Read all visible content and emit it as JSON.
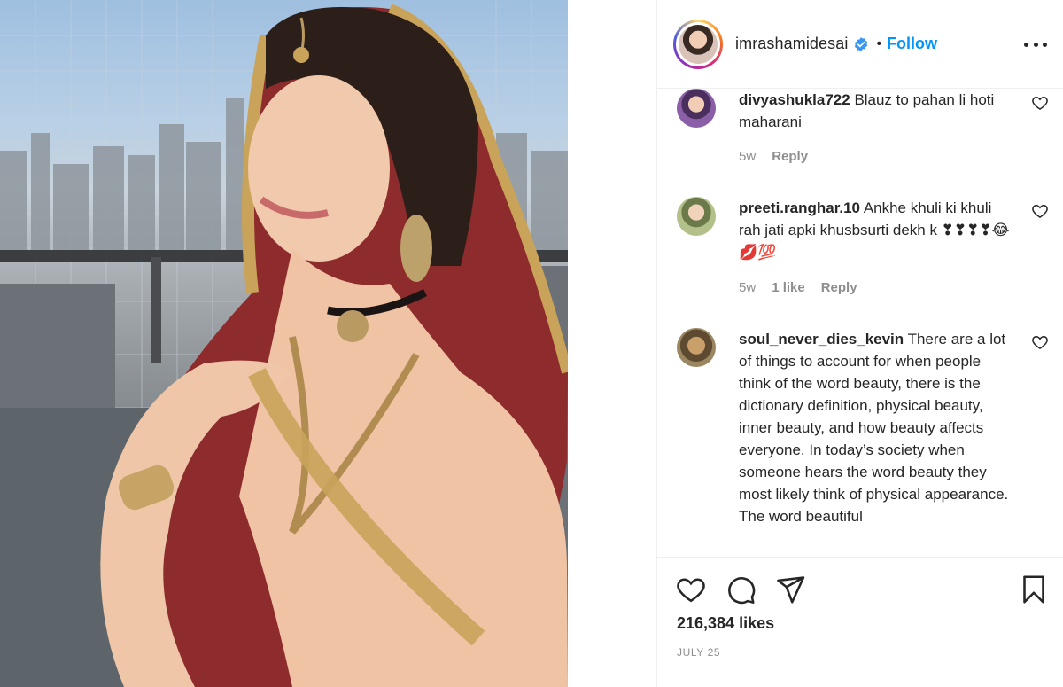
{
  "post": {
    "username": "imrashamidesai",
    "verified": true,
    "separator": "•",
    "follow_label": "Follow",
    "likes": "216,384 likes",
    "date": "JULY 25"
  },
  "comments": [
    {
      "user": "divyashukla722",
      "text": "Blauz to pahan li hoti maharani",
      "time": "5w",
      "likes": "",
      "reply": "Reply",
      "avatar_color": "#6b4a7a"
    },
    {
      "user": "preeti.ranghar.10",
      "text": "Ankhe khuli ki khuli rah jati apki khusbsurti dekh k ❣❣❣❣😂💋💯",
      "time": "5w",
      "likes": "1 like",
      "reply": "Reply",
      "avatar_color": "#8fa06a"
    },
    {
      "user": "soul_never_dies_kevin",
      "text": "There are a lot of things to account for when people think of the word beauty, there is the dictionary definition, physical beauty, inner beauty, and how beauty affects everyone. In today’s society when someone hears the word beauty they most likely think of physical appearance. The word beautiful",
      "time": "",
      "likes": "",
      "reply": "",
      "avatar_color": "#7a6a48"
    }
  ],
  "icons": {
    "header_more": "more-options-icon",
    "verified": "verified-badge-icon",
    "comment_like": "heart-outline-icon",
    "like": "heart-icon",
    "comment": "comment-icon",
    "share": "share-icon",
    "save": "bookmark-icon"
  },
  "colors": {
    "accent": "#0095f6",
    "verified": "#3897f0",
    "muted": "#8e8e8e",
    "text": "#262626"
  }
}
